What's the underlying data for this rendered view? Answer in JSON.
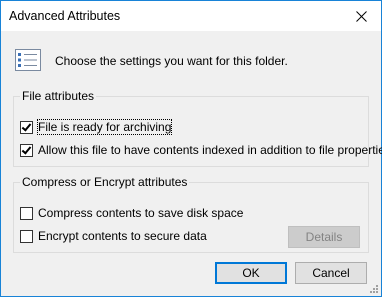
{
  "window": {
    "title": "Advanced Attributes",
    "close_icon": "close-icon"
  },
  "header": {
    "icon": "attributes-list-icon",
    "text": "Choose the settings you want for this folder."
  },
  "file_attributes": {
    "legend": "File attributes",
    "options": [
      {
        "label": "File is ready for archiving",
        "checked": true
      },
      {
        "label": "Allow this file to have contents indexed in addition to file properties",
        "checked": true
      }
    ]
  },
  "compress_encrypt": {
    "legend": "Compress or Encrypt attributes",
    "options": [
      {
        "label": "Compress contents to save disk space",
        "checked": false
      },
      {
        "label": "Encrypt contents to secure data",
        "checked": false
      }
    ],
    "details_label": "Details"
  },
  "buttons": {
    "ok": "OK",
    "cancel": "Cancel"
  },
  "colors": {
    "accent": "#0078d7",
    "border": "#1883d7",
    "dialog_bg": "#f0f0f0"
  }
}
